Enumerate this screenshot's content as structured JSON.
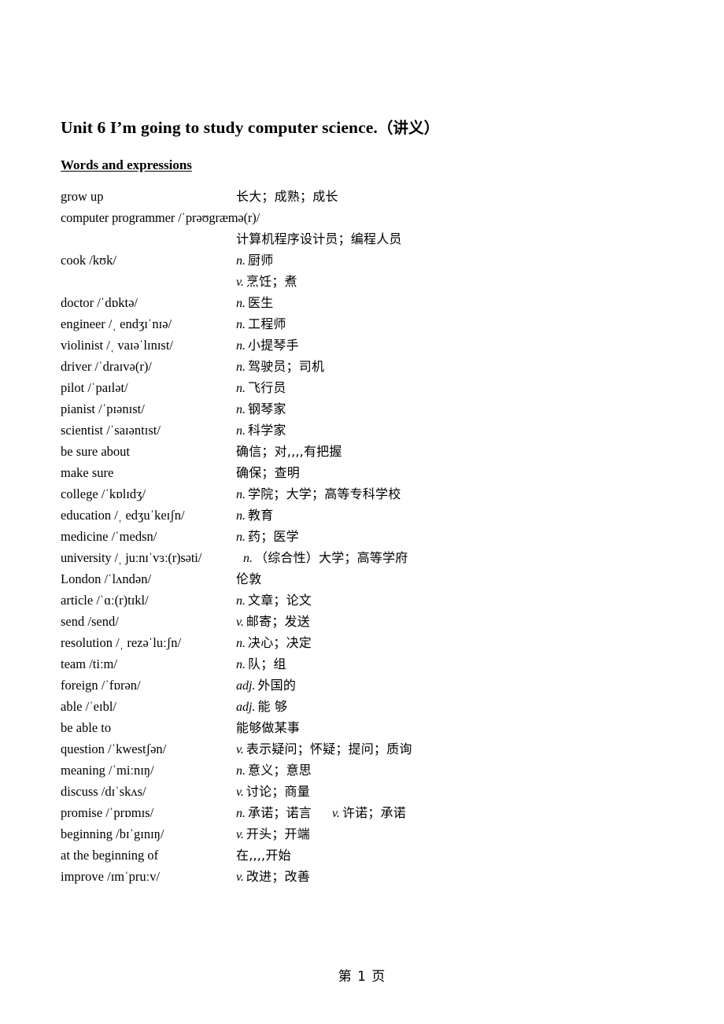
{
  "document": {
    "title_en": "Unit 6 I’m going to study computer science.",
    "title_cn": "（讲义）",
    "section_heading": "Words and expressions",
    "footer": "第 1 页"
  },
  "vocabulary": [
    {
      "term": "grow up",
      "pos": "",
      "meaning": "长大；成熟；成长"
    },
    {
      "term": "computer programmer /ˈprəʊgræmə(r)/",
      "pos": "",
      "meaning": ""
    },
    {
      "term": "",
      "pos": "",
      "meaning": "计算机程序设计员；编程人员"
    },
    {
      "term": "cook /kʊk/",
      "pos": "n.",
      "meaning": "厨师"
    },
    {
      "term": "",
      "pos": "v.",
      "meaning": "烹饪；煮"
    },
    {
      "term": "doctor /ˈdɒktə/",
      "pos": "n.",
      "meaning": "医生"
    },
    {
      "term": "engineer /ˌ endʒɪˈnɪə/",
      "pos": "n.",
      "meaning": "工程师"
    },
    {
      "term": "violinist /ˌ vaɪəˈlɪnɪst/",
      "pos": "n.",
      "meaning": "小提琴手"
    },
    {
      "term": "driver /ˈdraɪvə(r)/",
      "pos": "n.",
      "meaning": "驾驶员；司机"
    },
    {
      "term": "pilot /ˈpaɪlət/",
      "pos": "n.",
      "meaning": "飞行员"
    },
    {
      "term": "pianist /ˈpɪənɪst/",
      "pos": "n.",
      "meaning": "钢琴家"
    },
    {
      "term": "scientist /ˈsaɪəntɪst/",
      "pos": "n.",
      "meaning": "科学家"
    },
    {
      "term": "be sure about",
      "pos": "",
      "meaning": "确信；对,,,,有把握"
    },
    {
      "term": "make sure",
      "pos": "",
      "meaning": "确保；查明"
    },
    {
      "term": "college /ˈkɒlɪdʒ/",
      "pos": "n.",
      "meaning": "学院；大学；高等专科学校"
    },
    {
      "term": "education /ˌ edʒuˈkeɪʃn/",
      "pos": "n.",
      "meaning": "教育"
    },
    {
      "term": "medicine /ˈmedsn/",
      "pos": "n.",
      "meaning": "药；医学"
    },
    {
      "term": "university /ˌ juːnɪˈvɜː(r)səti/",
      "pos": "n.",
      "meaning": "（综合性）大学；高等学府"
    },
    {
      "term": "London /ˈlʌndən/",
      "pos": "",
      "meaning": "伦敦"
    },
    {
      "term": "article /ˈɑː(r)tɪkl/",
      "pos": "n.",
      "meaning": "文章；论文"
    },
    {
      "term": "send /send/",
      "pos": "v.",
      "meaning": "邮寄；发送"
    },
    {
      "term": "resolution /ˌ rezəˈluːʃn/",
      "pos": "n.",
      "meaning": "决心；决定"
    },
    {
      "term": "team /tiːm/",
      "pos": "n.",
      "meaning": "队；组"
    },
    {
      "term": "foreign /ˈfɒrən/",
      "pos": "adj.",
      "meaning": "外国的"
    },
    {
      "term": "able /ˈeɪbl/",
      "pos": "adj.",
      "meaning": "能 够"
    },
    {
      "term": "be able to",
      "pos": "",
      "meaning": "能够做某事"
    },
    {
      "term": "question /ˈkwestʃən/",
      "pos": "v.",
      "meaning": "表示疑问；怀疑；提问；质询"
    },
    {
      "term": "meaning /ˈmiːnɪŋ/",
      "pos": "n.",
      "meaning": "意义；意思"
    },
    {
      "term": "discuss /dɪˈskʌs/",
      "pos": "v.",
      "meaning": "讨论；商量"
    },
    {
      "term": "promise /ˈprɒmɪs/",
      "pos": "n.",
      "meaning": "承诺；诺言",
      "pos2": "v.",
      "meaning2": "许诺；承诺"
    },
    {
      "term": "beginning /bɪˈgɪnɪŋ/",
      "pos": "v.",
      "meaning": "开头；开端"
    },
    {
      "term": "at the beginning of",
      "pos": "",
      "meaning": "在,,,,开始"
    },
    {
      "term": "improve /ɪmˈpruːv/",
      "pos": "v.",
      "meaning": "改进；改善"
    }
  ]
}
